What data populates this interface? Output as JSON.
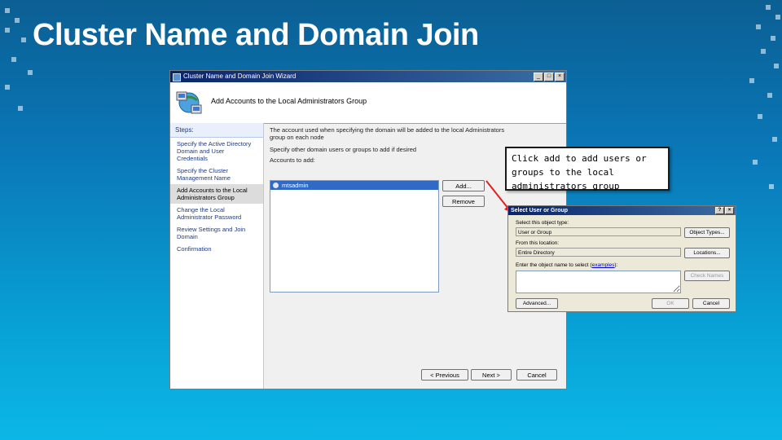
{
  "slide": {
    "title": "Cluster Name and Domain Join"
  },
  "wizard": {
    "title": "Cluster Name and Domain Join Wizard",
    "controls": {
      "minimize": "_",
      "maximize": "□",
      "close": "×"
    },
    "header": {
      "title": "Add Accounts to the Local Administrators Group",
      "icon": "computers-network-icon"
    },
    "steps": {
      "heading": "Steps:",
      "items": [
        {
          "label": "Specify the Active Directory Domain and User Credentials"
        },
        {
          "label": "Specify the Cluster Management Name"
        },
        {
          "label": "Add Accounts to the Local Administrators Group"
        },
        {
          "label": "Change the Local Administrator Password"
        },
        {
          "label": "Review Settings and Join Domain"
        },
        {
          "label": "Confirmation"
        }
      ],
      "active_index": 2
    },
    "description": "The account used when specifying the domain will be added to the local Administrators group on each node",
    "instruction": "Specify other domain users or groups to add if desired",
    "assigned_label": "Accounts to add:",
    "accounts": [
      {
        "name": "mtsadmin",
        "icon": "user-icon"
      }
    ],
    "buttons": {
      "add": "Add...",
      "remove": "Remove",
      "previous": "< Previous",
      "next": "Next >",
      "cancel": "Cancel"
    }
  },
  "callout": {
    "text": "Click add to add users or groups to the local administrators group",
    "arrow_color": "#e02020"
  },
  "select_dialog": {
    "title": "Select User or Group",
    "controls": {
      "help": "?",
      "close": "×"
    },
    "object_type_label": "Select this object type:",
    "object_type_value": "User or Group",
    "object_types_button": "Object Types...",
    "location_label": "From this location:",
    "location_value": "Entire Directory",
    "locations_button": "Locations...",
    "enter_label": "Enter the object name to select",
    "examples_link": "examples",
    "check_names_button": "Check Names",
    "advanced_button": "Advanced...",
    "ok_button": "OK",
    "cancel_button": "Cancel"
  }
}
